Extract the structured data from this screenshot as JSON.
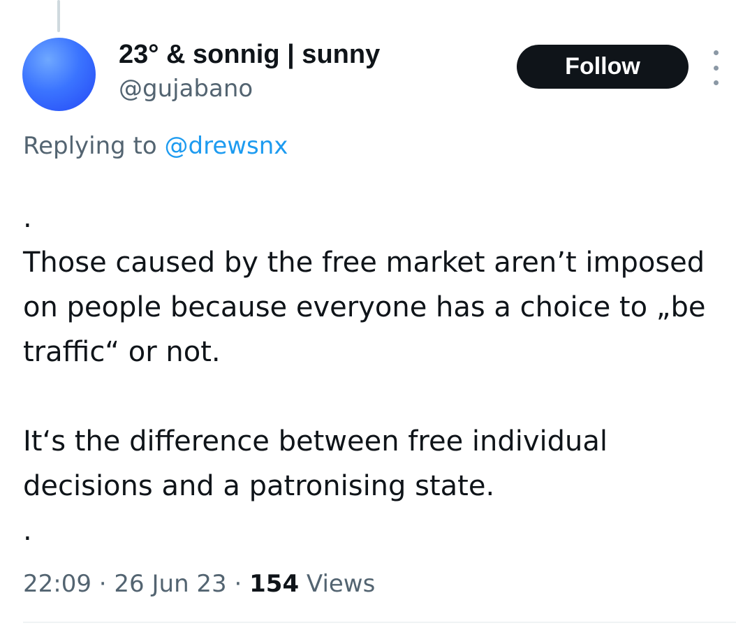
{
  "author": {
    "display_name": "23° & sonnig | sunny",
    "handle": "@gujabano"
  },
  "follow_label": "Follow",
  "reply": {
    "prefix": "Replying to ",
    "mention": "@drewsnx"
  },
  "tweet": {
    "lines": [
      ".",
      "Those caused by the free market aren’t imposed on people because everyone has a choice to „be traffic“ or not.",
      "",
      "It‘s the difference between free individual decisions and a patronising state.",
      "."
    ]
  },
  "meta": {
    "time": "22:09",
    "separator": " · ",
    "date": "26 Jun 23",
    "views_count": "154",
    "views_label": " Views"
  },
  "icons": {
    "more": "more-vertical-icon"
  },
  "colors": {
    "accent": "#1d9bf0",
    "avatar": "#2f5cff",
    "follow_bg": "#0f1419",
    "secondary_text": "#536471"
  }
}
